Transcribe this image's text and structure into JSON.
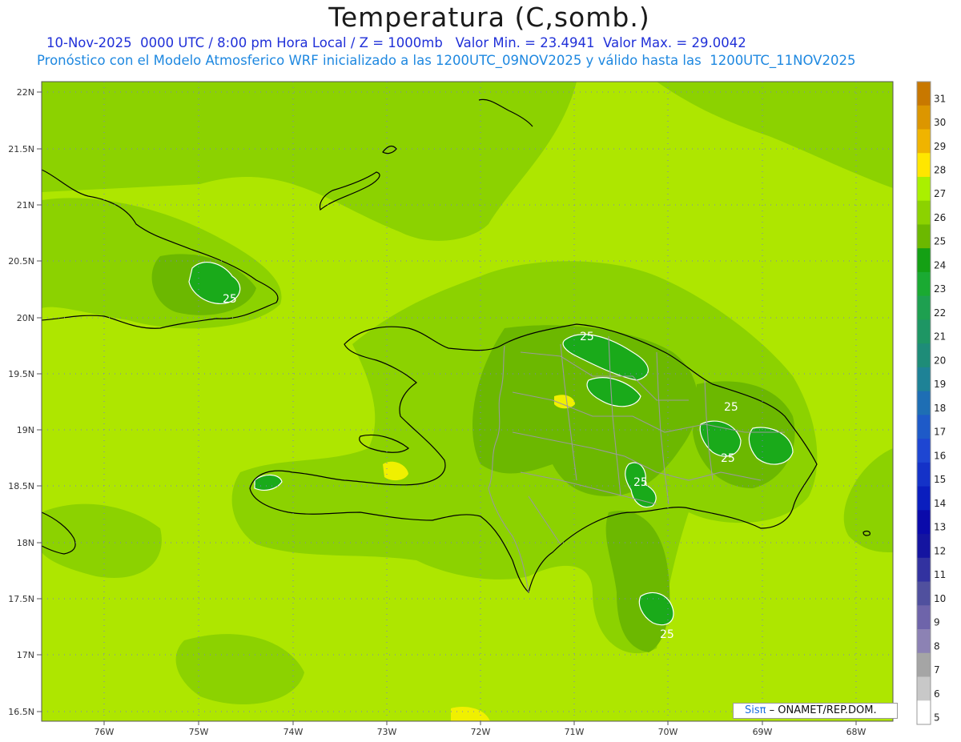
{
  "title": "Temperatura (C,somb.)",
  "subtitle_line1": "10-Nov-2025  0000 UTC / 8:00 pm Hora Local / Z = 1000mb   Valor Min. = 23.4941  Valor Max. = 29.0042",
  "subtitle_line2": "Pronóstico con el Modelo Atmosferico WRF inicializado a las 1200UTC_09NOV2025 y válido hasta las  1200UTC_11NOV2025",
  "map": {
    "lat_labels": [
      "22N",
      "21.5N",
      "21N",
      "20.5N",
      "20N",
      "19.5N",
      "19N",
      "18.5N",
      "18N",
      "17.5N",
      "17N",
      "16.5N"
    ],
    "lon_labels": [
      "76W",
      "75W",
      "74W",
      "73W",
      "72W",
      "71W",
      "70W",
      "69W",
      "68W"
    ],
    "contour_labels": [
      "25",
      "25",
      "25",
      "25",
      "25",
      "25"
    ],
    "colors": {
      "level_25": "#1aaa1a",
      "level_26": "#6cb800",
      "level_26b": "#8cd200",
      "level_27": "#aee600",
      "level_28": "#f0f000",
      "coastline": "#000000",
      "provinces": "#9a9a9a",
      "gridline": "#7a7acc"
    }
  },
  "colorbar": {
    "labels": [
      "31",
      "30",
      "29",
      "28",
      "27",
      "26",
      "25",
      "24",
      "23",
      "22",
      "21",
      "20",
      "19",
      "18",
      "17",
      "16",
      "15",
      "14",
      "13",
      "12",
      "11",
      "10",
      "9",
      "8",
      "7",
      "6",
      "5"
    ],
    "colors": [
      "#c87800",
      "#dc9600",
      "#f0b400",
      "#ffe600",
      "#aaf000",
      "#8cd200",
      "#6cb800",
      "#14a014",
      "#1aaa32",
      "#1ea050",
      "#1e9664",
      "#1e8c78",
      "#1e8296",
      "#1e6eb4",
      "#1e5ac8",
      "#1e46d2",
      "#1432c8",
      "#0a1ebe",
      "#0a0aaa",
      "#1414a0",
      "#3232a0",
      "#50509e",
      "#6e64aa",
      "#8c82b4",
      "#a5a5a5",
      "#c8c8c8",
      "#ffffff"
    ]
  },
  "credit": {
    "sis": "Sisπ",
    "org": " – ONAMET/REP.DOM."
  }
}
